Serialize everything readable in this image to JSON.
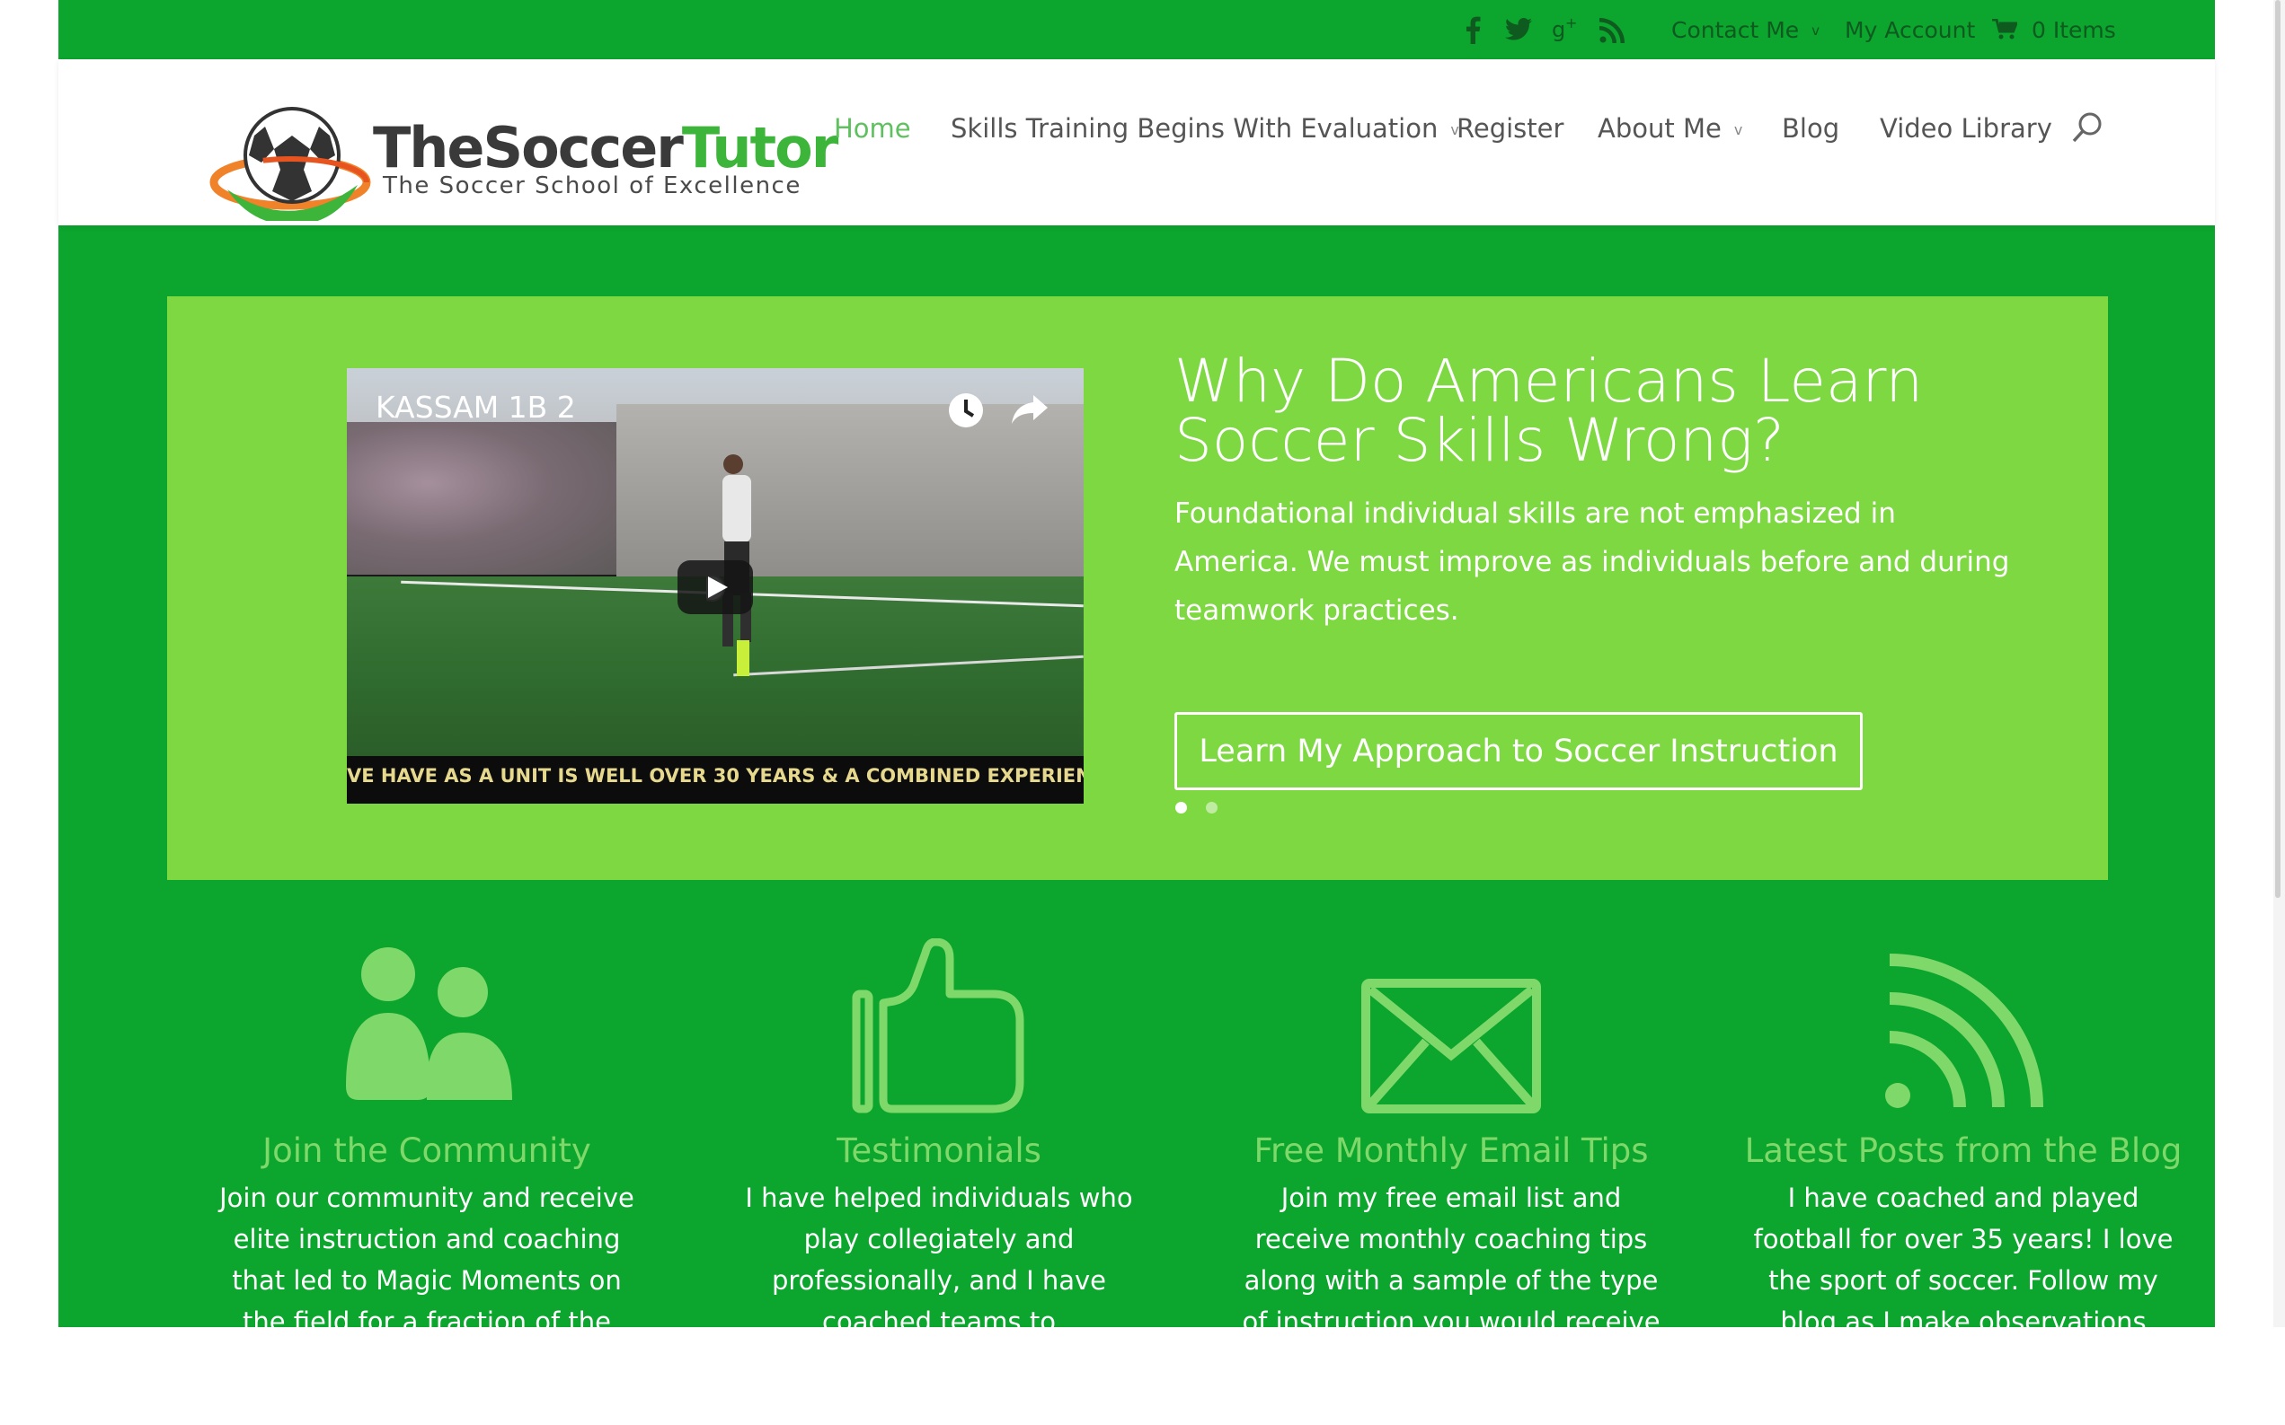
{
  "topbar": {
    "social": [
      "facebook-icon",
      "twitter-icon",
      "google-plus-icon",
      "rss-icon"
    ],
    "contact_label": "Contact Me",
    "account_label": "My Account",
    "cart_label": "0 Items"
  },
  "brand": {
    "name_part1": "TheSoccer",
    "name_part2": "Tutor",
    "tagline": "The Soccer School of Excellence"
  },
  "nav": {
    "home": "Home",
    "skills": "Skills Training Begins With Evaluation",
    "register": "Register",
    "about": "About Me",
    "blog": "Blog",
    "video": "Video Library"
  },
  "slider": {
    "video_title": "KASSAM 1B 2",
    "video_subtitle": "VE HAVE AS A UNIT IS WELL OVER 30  YEARS & A COMBINED EXPERIENCE OF O",
    "title": "Why Do Americans Learn Soccer Skills Wrong?",
    "description": "Foundational individual skills are not emphasized in America. We must improve as individuals before and during teamwork practices.",
    "button": "Learn My Approach to Soccer Instruction",
    "active_slide": 1,
    "slide_count": 2
  },
  "features": [
    {
      "icon": "community-icon",
      "title": "Join the Community",
      "text": "Join our community and receive elite instruction and coaching that led to Magic Moments on the field for a fraction of the cost of onsite"
    },
    {
      "icon": "thumbs-up-icon",
      "title": "Testimonials",
      "text": "I have helped individuals who play collegiately and professionally, and I have coached teams to championships. Hear what others"
    },
    {
      "icon": "envelope-icon",
      "title": "Free Monthly Email Tips",
      "text": "Join my free email list and receive monthly coaching tips along with a sample of the type of instruction you would receive as a"
    },
    {
      "icon": "rss-icon",
      "title": "Latest Posts from the Blog",
      "text": "I have coached and played football for over 35 years! I love the sport of soccer. Follow my blog as I make observations about"
    }
  ],
  "colors": {
    "page_green": "#0ca52d",
    "slider_green": "#7ed842",
    "accent_light_green": "#7fd86a"
  }
}
